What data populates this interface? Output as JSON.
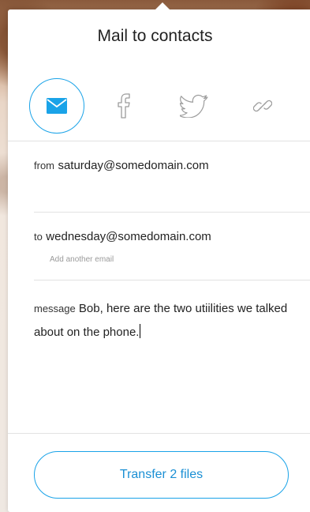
{
  "panel": {
    "title": "Mail to contacts"
  },
  "share_options": [
    {
      "name": "mail",
      "icon": "envelope-icon",
      "selected": true
    },
    {
      "name": "facebook",
      "icon": "facebook-icon",
      "selected": false
    },
    {
      "name": "twitter",
      "icon": "twitter-icon",
      "selected": false
    },
    {
      "name": "link",
      "icon": "link-icon",
      "selected": false
    }
  ],
  "form": {
    "from_label": "from",
    "from_value": "saturday@somedomain.com",
    "to_label": "to",
    "to_value": "wednesday@somedomain.com",
    "add_email": "Add another email",
    "message_label": "message",
    "message_value": "Bob, here are the two utiilities we talked about on the phone."
  },
  "actions": {
    "transfer_label": "Transfer 2 files"
  },
  "colors": {
    "accent": "#1aa3e8",
    "text": "#222222",
    "muted": "#9a9a9a",
    "icon_grey": "#9c9c9c"
  }
}
